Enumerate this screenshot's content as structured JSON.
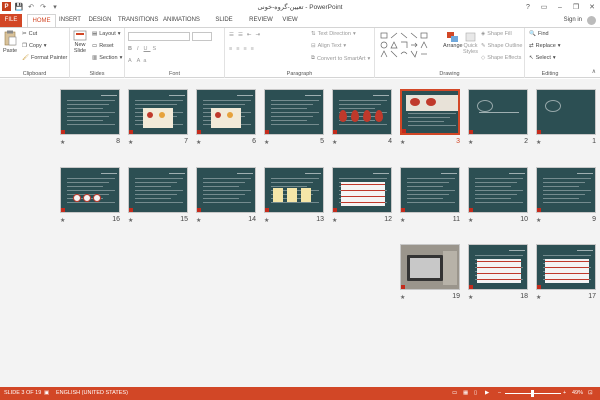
{
  "app": {
    "title": "تعیین-گروه-خونی  -  PowerPoint",
    "sign_in": "Sign in",
    "win_buttons": [
      "?",
      "▭",
      "–",
      "❐",
      "✕"
    ]
  },
  "qat": {
    "save": "💾",
    "undo": "↶",
    "redo": "↷",
    "customize": "▾"
  },
  "tabs": [
    {
      "label": "FILE"
    },
    {
      "label": "HOME"
    },
    {
      "label": "INSERT"
    },
    {
      "label": "DESIGN"
    },
    {
      "label": "TRANSITIONS"
    },
    {
      "label": "ANIMATIONS"
    },
    {
      "label": "SLIDE SHOW"
    },
    {
      "label": "REVIEW"
    },
    {
      "label": "VIEW"
    }
  ],
  "ribbon": {
    "clipboard": {
      "label": "Clipboard",
      "paste": "Paste",
      "cut": "Cut",
      "copy": "Copy",
      "format_painter": "Format Painter"
    },
    "slides": {
      "label": "Slides",
      "new_slide": "New",
      "new_slide2": "Slide",
      "layout": "Layout",
      "reset": "Reset",
      "section": "Section"
    },
    "font": {
      "label": "Font"
    },
    "paragraph": {
      "label": "Paragraph",
      "text_direction": "Text Direction",
      "align_text": "Align Text",
      "convert_smartart": "Convert to SmartArt"
    },
    "drawing": {
      "label": "Drawing",
      "arrange": "Arrange",
      "quick_styles": "Quick",
      "quick_styles2": "Styles",
      "shape_fill": "Shape Fill",
      "shape_outline": "Shape Outline",
      "shape_effects": "Shape Effects"
    },
    "editing": {
      "label": "Editing",
      "find": "Find",
      "replace": "Replace",
      "select": "Select"
    }
  },
  "slides": [
    {
      "num": "1"
    },
    {
      "num": "2"
    },
    {
      "num": "3"
    },
    {
      "num": "4"
    },
    {
      "num": "5"
    },
    {
      "num": "6"
    },
    {
      "num": "7"
    },
    {
      "num": "8"
    },
    {
      "num": "9"
    },
    {
      "num": "10"
    },
    {
      "num": "11"
    },
    {
      "num": "12"
    },
    {
      "num": "13"
    },
    {
      "num": "14"
    },
    {
      "num": "15"
    },
    {
      "num": "16"
    },
    {
      "num": "17"
    },
    {
      "num": "18"
    },
    {
      "num": "19"
    }
  ],
  "selected_slide": 3,
  "slide_star": "★",
  "status": {
    "slide_info": "SLIDE 3 OF 19",
    "language": "ENGLISH (UNITED STATES)",
    "zoom": "49%",
    "zoom_minus": "–",
    "zoom_plus": "+"
  },
  "colors": {
    "accent": "#d24726",
    "slide_bg": "#2c4f53"
  }
}
